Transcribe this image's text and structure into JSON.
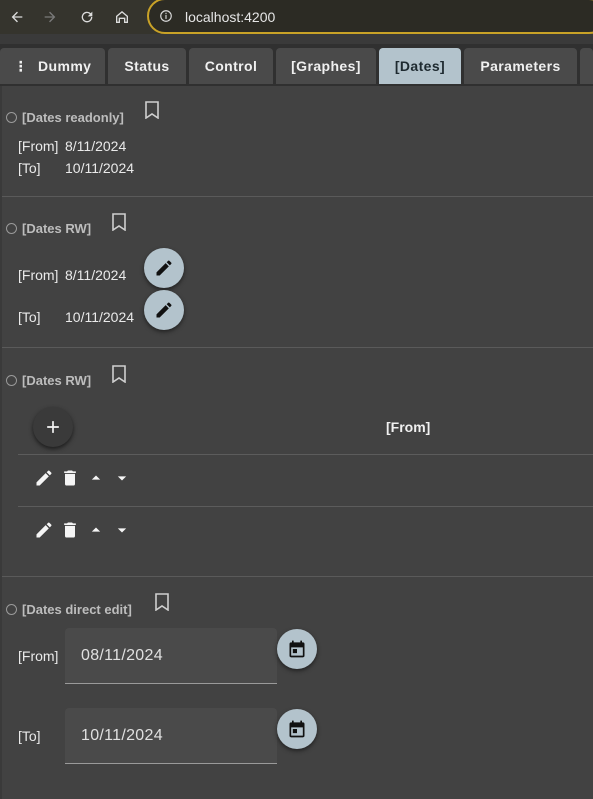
{
  "browser": {
    "url": "localhost:4200"
  },
  "tabs": [
    {
      "label": "Dummy"
    },
    {
      "label": "Status"
    },
    {
      "label": "Control"
    },
    {
      "label": "[Graphes]"
    },
    {
      "label": "[Dates]",
      "active": true
    },
    {
      "label": "Parameters"
    }
  ],
  "section1": {
    "title": "[Dates readonly]",
    "from_label": "[From]",
    "from_value": "8/11/2024",
    "to_label": "[To]",
    "to_value": "10/11/2024"
  },
  "section2": {
    "title": "[Dates RW]",
    "from_label": "[From]",
    "from_value": "8/11/2024",
    "to_label": "[To]",
    "to_value": "10/11/2024"
  },
  "section3": {
    "title": "[Dates RW]",
    "column_header": "[From]"
  },
  "section4": {
    "title": "[Dates direct edit]",
    "from_label": "[From]",
    "from_value": "08/11/2024",
    "to_label": "[To]",
    "to_value": "10/11/2024"
  },
  "colors": {
    "accent": "#b3c3cc",
    "url_border": "#c9a227",
    "background": "#424242"
  }
}
